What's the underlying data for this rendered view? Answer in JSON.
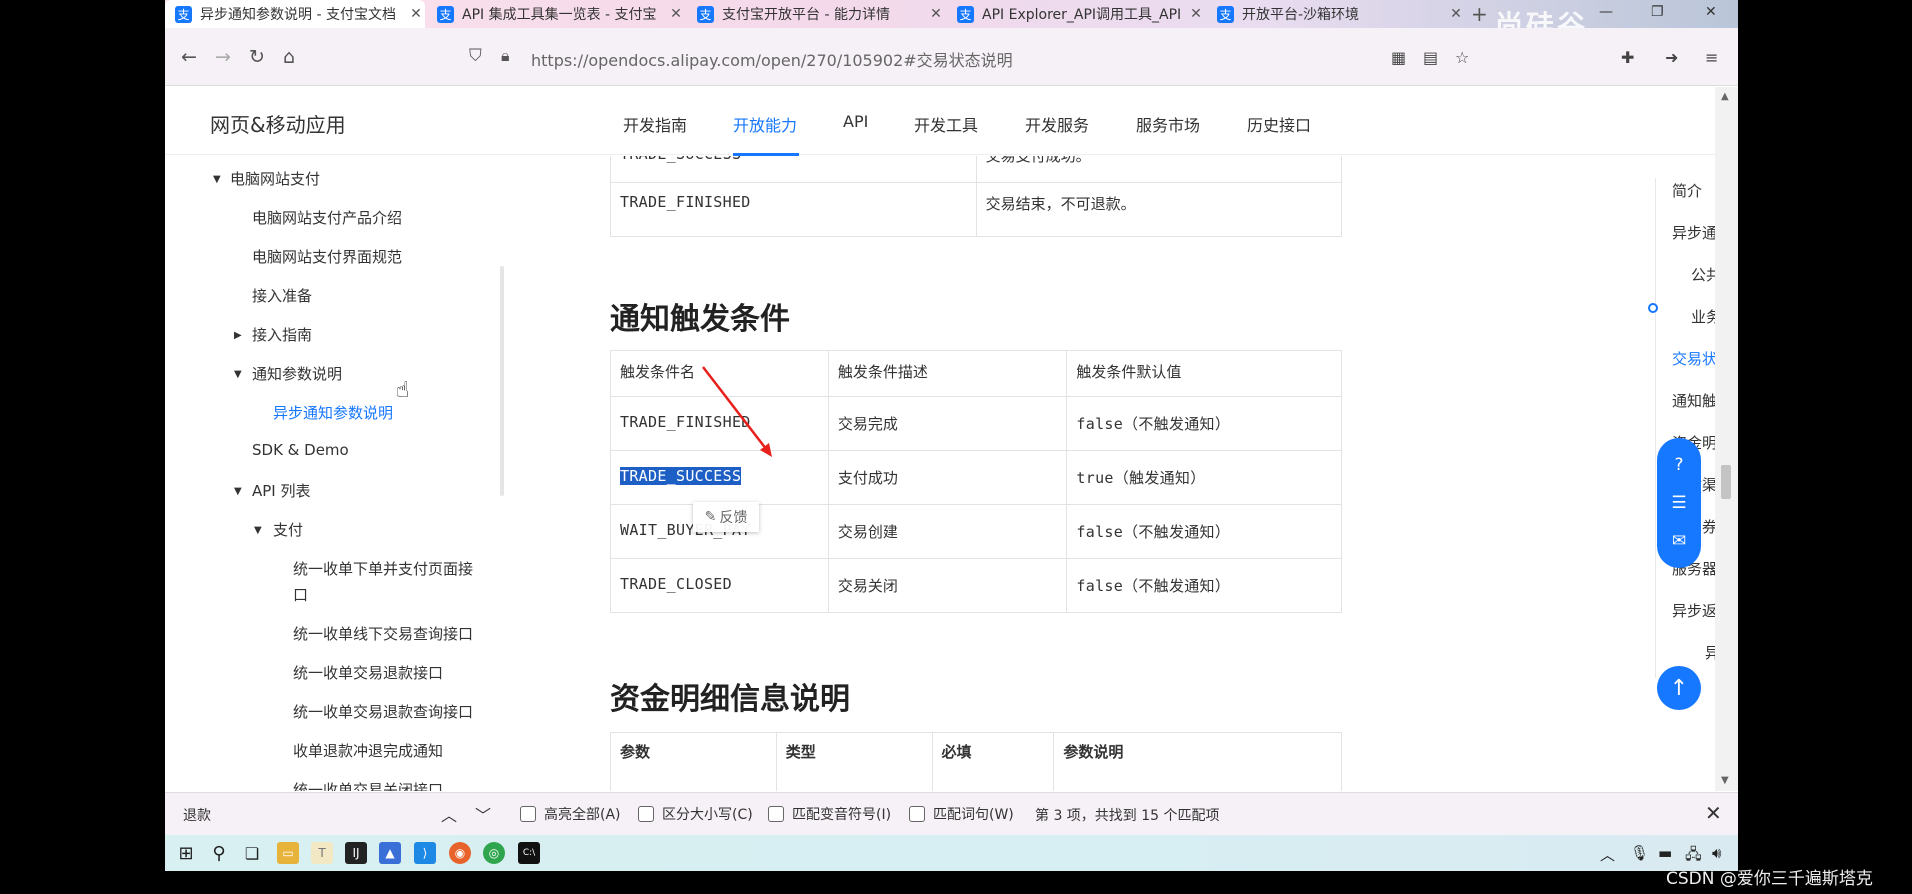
{
  "browser": {
    "tabs": [
      {
        "title": "异步通知参数说明 - 支付宝文档",
        "active": true
      },
      {
        "title": "API 集成工具集一览表 - 支付宝",
        "active": false
      },
      {
        "title": "支付宝开放平台 - 能力详情",
        "active": false
      },
      {
        "title": "API Explorer_API调用工具_API",
        "active": false
      },
      {
        "title": "开放平台-沙箱环境",
        "active": false
      }
    ],
    "favicon_glyph": "支",
    "new_tab": "+",
    "close_glyph": "✕",
    "watermark": "尚硅谷",
    "url": "https://opendocs.alipay.com/open/270/105902#交易状态说明"
  },
  "site": {
    "title": "网页&移动应用",
    "nav": [
      "开发指南",
      "开放能力",
      "API",
      "开发工具",
      "开发服务",
      "服务市场",
      "历史接口"
    ],
    "active_nav": "开放能力"
  },
  "sidebar": {
    "items": [
      {
        "label": "电脑网站支付",
        "level": 0,
        "arrow": "down"
      },
      {
        "label": "电脑网站支付产品介绍",
        "level": 1
      },
      {
        "label": "电脑网站支付界面规范",
        "level": 1
      },
      {
        "label": "接入准备",
        "level": 1
      },
      {
        "label": "接入指南",
        "level": 1,
        "arrow": "right"
      },
      {
        "label": "通知参数说明",
        "level": 1,
        "arrow": "down"
      },
      {
        "label": "异步通知参数说明",
        "level": 2,
        "active": true
      },
      {
        "label": "SDK & Demo",
        "level": 1
      },
      {
        "label": "API 列表",
        "level": 1,
        "arrow": "down"
      },
      {
        "label": "支付",
        "level": 2,
        "arrow": "down"
      },
      {
        "label": "统一收单下单并支付页面接",
        "label2": "口",
        "level": 3
      },
      {
        "label": "统一收单线下交易查询接口",
        "level": 3
      },
      {
        "label": "统一收单交易退款接口",
        "level": 3
      },
      {
        "label": "统一收单交易退款查询接口",
        "level": 3
      },
      {
        "label": "收单退款冲退完成通知",
        "level": 3
      },
      {
        "label": "统一收单交易关闭接口",
        "level": 3
      }
    ]
  },
  "content": {
    "status_table_rows": [
      [
        "TRADE_SUCCESS",
        "交易支付成功。"
      ],
      [
        "TRADE_FINISHED",
        "交易结束，不可退款。"
      ]
    ],
    "trigger_heading": "通知触发条件",
    "trigger_headers": [
      "触发条件名",
      "触发条件描述",
      "触发条件默认值"
    ],
    "trigger_rows": [
      [
        "TRADE_FINISHED",
        "交易完成",
        "false（不触发通知）"
      ],
      [
        "TRADE_SUCCESS",
        "支付成功",
        "true（触发通知）"
      ],
      [
        "WAIT_BUYER_PAY",
        "交易创建",
        "false（不触发通知）"
      ],
      [
        "TRADE_CLOSED",
        "交易关闭",
        "false（不触发通知）"
      ]
    ],
    "feedback_label": "反馈",
    "fund_heading": "资金明细信息说明",
    "fund_headers": [
      "参数",
      "类型",
      "必填",
      "参数说明"
    ]
  },
  "toc": {
    "items": [
      {
        "label": "简介",
        "indent": false
      },
      {
        "label": "异步通知参数",
        "indent": false
      },
      {
        "label": "公共参数",
        "indent": true
      },
      {
        "label": "业务参数",
        "indent": true
      },
      {
        "label": "交易状态说明",
        "indent": false,
        "active": true
      },
      {
        "label": "通知触发条件",
        "indent": false
      },
      {
        "label": "资金明细信息说明",
        "indent": false
      },
      {
        "label": "支付渠道说明",
        "indent": false
      },
      {
        "label": "优惠券信息说明",
        "indent": false
      },
      {
        "label": "服务器异步通知页面特性",
        "indent": false
      },
      {
        "label": "异步返回结果的验签",
        "indent": false
      },
      {
        "label": "异步通知验签",
        "indent": true,
        "deep": true
      }
    ],
    "back_to_top": "↑"
  },
  "findbar": {
    "query": "退款",
    "options": [
      "高亮全部(A)",
      "区分大小写(C)",
      "匹配变音符号(I)",
      "匹配词句(W)"
    ],
    "status": "第 3 项，共找到 15 个匹配项"
  },
  "overlay": {
    "csdn_credit": "CSDN @爱你三千遍斯塔克"
  },
  "colors": {
    "accent": "#1677ff",
    "highlight": "#1e5fc6",
    "annotation_arrow": "#e8201c"
  }
}
